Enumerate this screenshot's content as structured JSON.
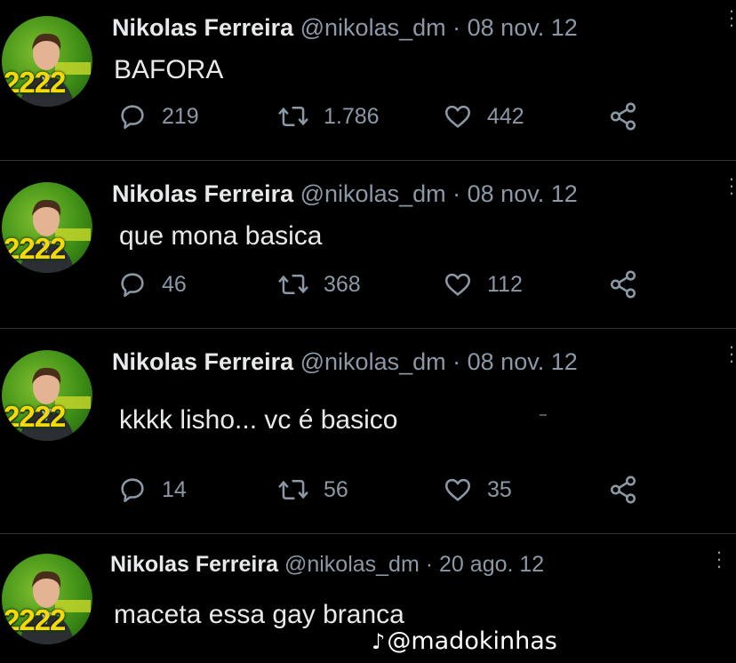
{
  "tweets": [
    {
      "name": "Nikolas Ferreira",
      "handle": "@nikolas_dm",
      "separator": "·",
      "date": "08 nov. 12",
      "text": "BAFORA",
      "replies": "219",
      "retweets": "1.786",
      "likes": "442",
      "avatar_badge": "2222"
    },
    {
      "name": "Nikolas Ferreira",
      "handle": "@nikolas_dm",
      "separator": "·",
      "date": "08 nov. 12",
      "text": "que mona basica",
      "replies": "46",
      "retweets": "368",
      "likes": "112",
      "avatar_badge": "2222"
    },
    {
      "name": "Nikolas Ferreira",
      "handle": "@nikolas_dm",
      "separator": "·",
      "date": "08 nov. 12",
      "text": "kkkk lisho... vc é basico",
      "replies": "14",
      "retweets": "56",
      "likes": "35",
      "avatar_badge": "2222"
    },
    {
      "name": "Nikolas Ferreira",
      "handle": "@nikolas_dm",
      "separator": "·",
      "date": "20 ago. 12",
      "text": "maceta essa gay branca",
      "avatar_badge": "2222"
    }
  ],
  "icons": {
    "reply": "reply-icon",
    "retweet": "retweet-icon",
    "like": "heart-icon",
    "share": "share-icon",
    "more": "more-icon",
    "tiktok": "tiktok-icon"
  },
  "watermark": {
    "logo": "♪",
    "text": "@madokinhas"
  },
  "colors": {
    "background": "#000000",
    "text": "#e7e9ea",
    "secondary": "#8b98a5",
    "divider": "#2f3336",
    "avatar_green": "#3f8f17",
    "avatar_badge": "#f5d90a"
  }
}
